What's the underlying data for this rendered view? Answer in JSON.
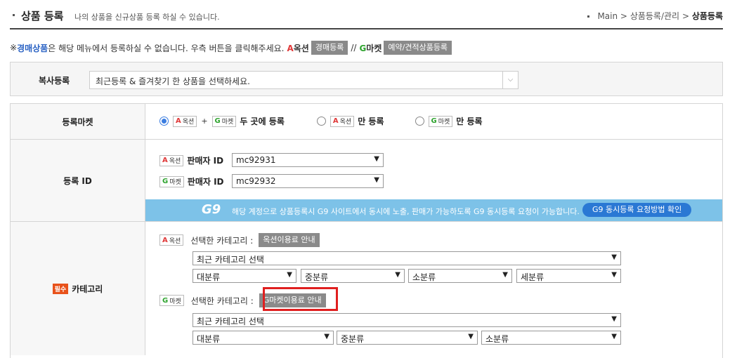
{
  "header": {
    "title": "상품 등록",
    "description": "나의 상품을 신규상품 등록 하실 수 있습니다.",
    "breadcrumb": {
      "main": "Main",
      "sep1": ">",
      "mid": "상품등록/관리",
      "sep2": ">",
      "current": "상품등록"
    }
  },
  "notice": {
    "prefix": "※",
    "highlight": "경매상품",
    "text": "은 해당 메뉴에서 등록하실 수 없습니다. 우측 버튼을 클릭해주세요.",
    "auction_mark": "A",
    "auction_label": "옥션",
    "auction_button": "경매등록",
    "divider": "//",
    "gmarket_mark": "G",
    "gmarket_label": "마켓",
    "gmarket_button": "예약/견적상품등록"
  },
  "copy": {
    "label": "복사등록",
    "placeholder": "최근등록 & 즐겨찾기 한 상품을 선택하세요.",
    "arrow": "⌵"
  },
  "market": {
    "label": "등록마켓",
    "auction_badge": "옥션",
    "gmarket_badge": "마켓",
    "a": "A",
    "g": "G",
    "plus": "+",
    "both": "두 곳에 등록",
    "only": "만 등록"
  },
  "reg_id": {
    "label": "등록 ID",
    "seller_label": "판매자 ID",
    "auction_id": "mc92931",
    "gmarket_id": "mc92932"
  },
  "g9": {
    "logo": "G9",
    "text": "해당 계정으로 상품등록시 G9 사이트에서 동시에 노출, 판매가 가능하도록 G9 동시등록 요청이 가능합니다.",
    "button": "G9 동시등록 요청방법 확인"
  },
  "category": {
    "required": "필수",
    "label": "카테고리",
    "selected_label": "선택한 카테고리 :",
    "auction_guide": "옥션이용료 안내",
    "gmarket_guide": "G마켓이용료 안내",
    "recent": "최근 카테고리 선택",
    "large": "대분류",
    "medium": "중분류",
    "small": "소분류",
    "detail": "세분류"
  },
  "colors": {
    "accent_blue": "#3b7de0",
    "g9_bar": "#7dc2e8",
    "highlight_red": "#e01f1f",
    "required_orange": "#e8521b"
  }
}
